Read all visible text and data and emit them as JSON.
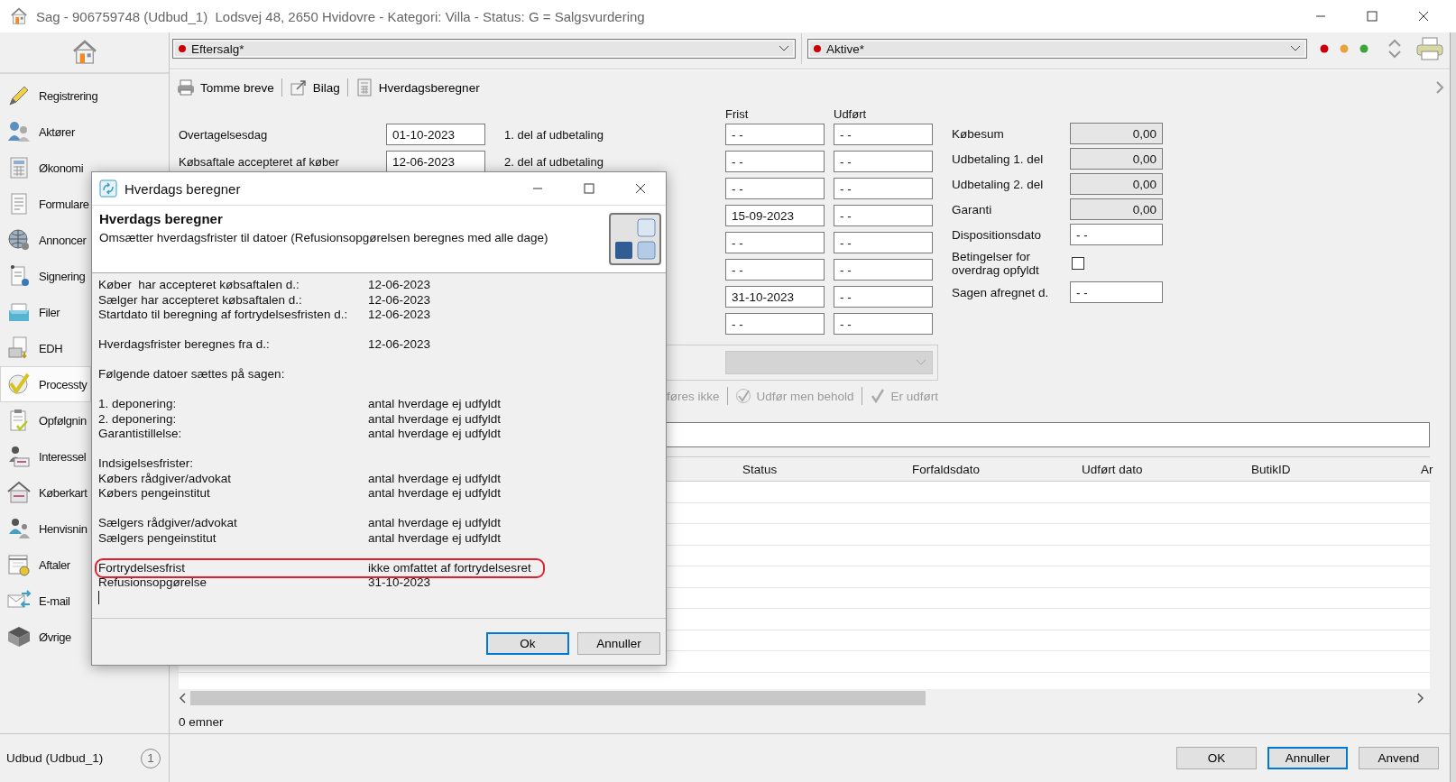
{
  "window": {
    "title": "Sag - 906759748 (Udbud_1)  Lodsvej 48, 2650 Hvidovre - Kategori: Villa - Status: G = Salgsvurdering"
  },
  "sidebar": {
    "items": [
      {
        "label": "Registrering",
        "selected": false
      },
      {
        "label": "Aktører",
        "selected": false
      },
      {
        "label": "Økonomi",
        "selected": false
      },
      {
        "label": "Formulare",
        "selected": false
      },
      {
        "label": "Annoncer",
        "selected": false
      },
      {
        "label": "Signering",
        "selected": false
      },
      {
        "label": "Filer",
        "selected": false
      },
      {
        "label": "EDH",
        "selected": false
      },
      {
        "label": "Processty",
        "selected": true
      },
      {
        "label": "Opfølgnin",
        "selected": false
      },
      {
        "label": "Interessel",
        "selected": false
      },
      {
        "label": "Køberkart",
        "selected": false
      },
      {
        "label": "Henvisnin",
        "selected": false
      },
      {
        "label": "Aftaler",
        "selected": false
      },
      {
        "label": "E-mail",
        "selected": false
      },
      {
        "label": "Øvrige",
        "selected": false
      }
    ],
    "footer": {
      "label": "Udbud (Udbud_1)",
      "count": "1"
    }
  },
  "selectors": [
    {
      "value": "Eftersalg*"
    },
    {
      "value": "Aktive*"
    }
  ],
  "toolbar": [
    {
      "label": "Tomme breve"
    },
    {
      "label": "Bilag"
    },
    {
      "label": "Hverdagsberegner"
    }
  ],
  "form": {
    "columns": [
      "Frist",
      "Udført"
    ],
    "rows": [
      {
        "label": "Overtagelsesdag",
        "value": "01-10-2023",
        "payment": "1. del af udbetaling",
        "due": "- -",
        "done": "- -"
      },
      {
        "label": "Købsaftale accepteret af køber",
        "value": "12-06-2023",
        "payment": "2. del af udbetaling",
        "due": "- -",
        "done": "- -"
      },
      {
        "due": "- -",
        "done": "- -"
      },
      {
        "due": "15-09-2023",
        "done": "- -"
      },
      {
        "due": "- -",
        "done": "- -"
      },
      {
        "due": "- -",
        "done": "- -"
      },
      {
        "due": "31-10-2023",
        "done": "- -"
      },
      {
        "due": "- -",
        "done": "- -"
      }
    ]
  },
  "amounts": [
    {
      "kind": "amount",
      "label": "Købesum",
      "value": "0,00"
    },
    {
      "kind": "amount",
      "label": "Udbetaling 1. del",
      "value": "0,00"
    },
    {
      "kind": "amount",
      "label": "Udbetaling 2. del",
      "value": "0,00"
    },
    {
      "kind": "amount",
      "label": "Garanti",
      "value": "0,00"
    },
    {
      "kind": "date",
      "label": "Dispositionsdato",
      "value": "- -"
    },
    {
      "kind": "checkbox",
      "label": "Betingelser for overdrag opfyldt",
      "checked": false
    },
    {
      "kind": "date",
      "label": "Sagen afregnet d.",
      "value": "- -"
    }
  ],
  "task_dropdown": {
    "disabled": true
  },
  "actions": [
    {
      "label": "føres ikke",
      "disabled": true
    },
    {
      "label": "Udfør men behold",
      "disabled": true
    },
    {
      "label": "Er udført",
      "disabled": true
    }
  ],
  "table": {
    "columns": [
      "Status",
      "Forfaldsdato",
      "Udført dato",
      "ButikID",
      "Ar"
    ],
    "count": "0 emner"
  },
  "buttons": [
    {
      "label": "OK",
      "focused": false
    },
    {
      "label": "Annuller",
      "focused": true
    },
    {
      "label": "Anvend",
      "focused": false
    }
  ],
  "dialog": {
    "title": "Hverdags beregner",
    "heading": "Hverdags beregner",
    "description": "Omsætter hverdagsfrister til datoer (Refusionsopgørelsen beregnes med alle dage)",
    "groups": [
      [
        {
          "label": "Køber  har accepteret købsaftalen d.:",
          "value": "12-06-2023",
          "highlighted": false
        },
        {
          "label": "Sælger har accepteret købsaftalen d.:",
          "value": "12-06-2023",
          "highlighted": false
        },
        {
          "label": "Startdato til beregning af fortrydelsesfristen d.:",
          "value": "12-06-2023",
          "highlighted": false
        }
      ],
      [
        {
          "label": "Hverdagsfrister beregnes fra d.:",
          "value": "12-06-2023",
          "highlighted": false
        }
      ],
      [
        {
          "label": "Følgende datoer sættes på sagen:",
          "highlighted": false
        }
      ],
      [
        {
          "label": "1. deponering:",
          "value": "antal hverdage ej udfyldt",
          "highlighted": false
        },
        {
          "label": "2. deponering:",
          "value": "antal hverdage ej udfyldt",
          "highlighted": false
        },
        {
          "label": "Garantistillelse:",
          "value": "antal hverdage ej udfyldt",
          "highlighted": false
        }
      ],
      [
        {
          "label": "Indsigelsesfrister:",
          "highlighted": false
        },
        {
          "label": "Købers rådgiver/advokat",
          "value": "antal hverdage ej udfyldt",
          "highlighted": false
        },
        {
          "label": "Købers pengeinstitut",
          "value": "antal hverdage ej udfyldt",
          "highlighted": false
        }
      ],
      [
        {
          "label": "Sælgers rådgiver/advokat",
          "value": "antal hverdage ej udfyldt",
          "highlighted": false
        },
        {
          "label": "Sælgers pengeinstitut",
          "value": "antal hverdage ej udfyldt",
          "highlighted": false
        }
      ],
      [
        {
          "label": "Fortrydelsesfrist",
          "value": "ikke omfattet af fortrydelsesret",
          "highlighted": true
        },
        {
          "label": "Refusionsopgørelse",
          "value": "31-10-2023",
          "highlighted": false
        }
      ]
    ],
    "buttons": [
      {
        "label": "Ok",
        "focused": true
      },
      {
        "label": "Annuller",
        "focused": false
      }
    ]
  }
}
